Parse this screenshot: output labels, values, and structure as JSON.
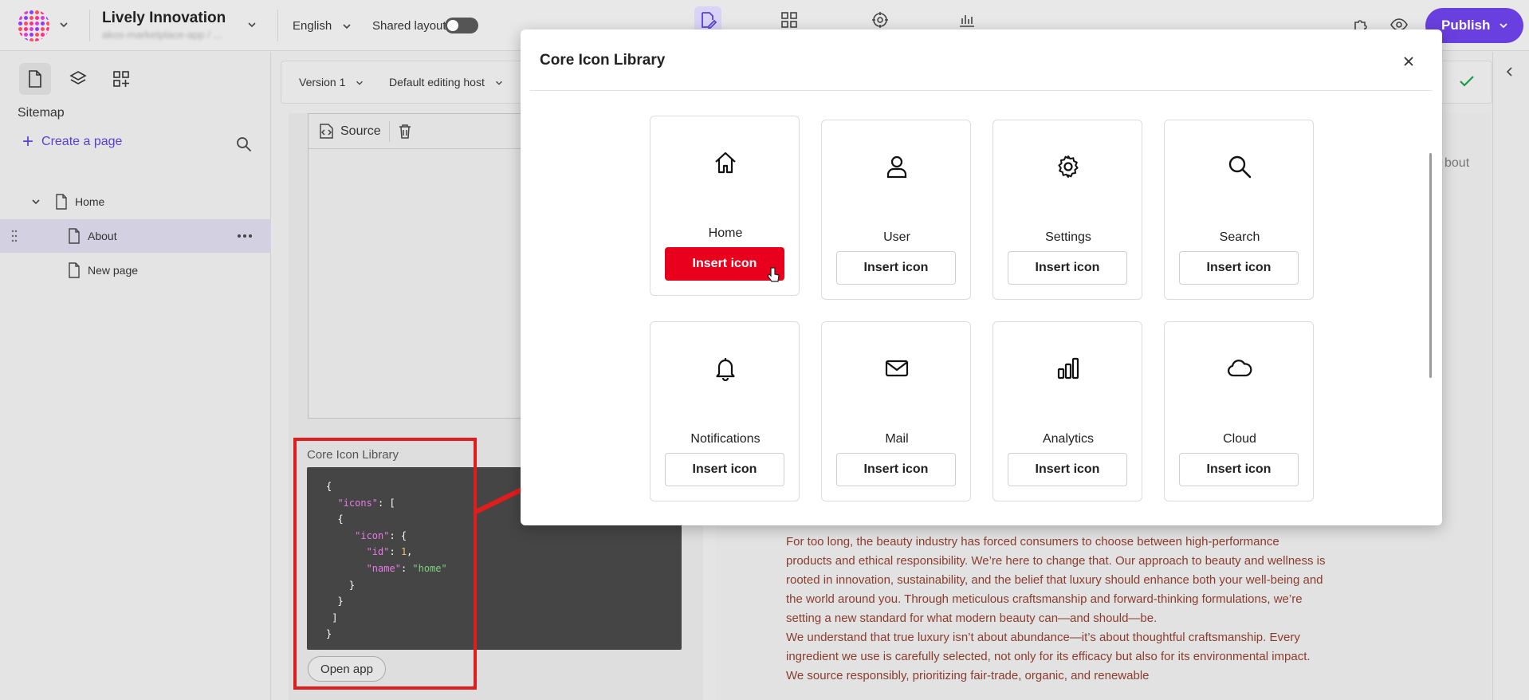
{
  "topbar": {
    "site_name": "Lively Innovation",
    "site_sub": "akos-marketplace-app / ...",
    "language": "English",
    "shared_layout_label": "Shared layout",
    "publish_label": "Publish"
  },
  "sidebar": {
    "title": "Sitemap",
    "create_page": "Create a page",
    "tree": [
      {
        "label": "Home"
      },
      {
        "label": "About"
      },
      {
        "label": "New page"
      }
    ]
  },
  "version_bar": {
    "version": "Version 1",
    "host": "Default editing host"
  },
  "editor": {
    "source_label": "Source",
    "component_label": "Core Icon Library",
    "open_app": "Open app"
  },
  "code": {
    "l1": "{",
    "k_icons": "\"icons\"",
    "l2_tail": ": [",
    "l3": "  {",
    "k_icon": "\"icon\"",
    "l4_tail": ": {",
    "k_id": "\"id\"",
    "v_id": "1",
    "k_name": "\"name\"",
    "v_name": "\"home\"",
    "l7": "    }",
    "l8": "  }",
    "l9": " ]",
    "l10": "}"
  },
  "preview": {
    "about_peek": "bout",
    "p1": "For too long, the beauty industry has forced consumers to choose between high-performance products and ethical responsibility. We’re here to change that. Our approach to beauty and wellness is rooted in innovation, sustainability, and the belief that luxury should enhance both your well-being and the world around you. Through meticulous craftsmanship and forward-thinking formulations, we’re setting a new standard for what modern beauty can—and should—be.",
    "p2": "We understand that true luxury isn’t about abundance—it’s about thoughtful craftsmanship. Every ingredient we use is carefully selected, not only for its efficacy but also for its environmental impact. We source responsibly, prioritizing fair-trade, organic, and renewable"
  },
  "modal": {
    "title": "Core Icon Library",
    "insert_label": "Insert icon",
    "icons": [
      {
        "label": "Home",
        "icon": "home-icon"
      },
      {
        "label": "User",
        "icon": "user-icon"
      },
      {
        "label": "Settings",
        "icon": "gear-icon"
      },
      {
        "label": "Search",
        "icon": "search-icon"
      },
      {
        "label": "Notifications",
        "icon": "bell-icon"
      },
      {
        "label": "Mail",
        "icon": "mail-icon"
      },
      {
        "label": "Analytics",
        "icon": "bar-chart-icon"
      },
      {
        "label": "Cloud",
        "icon": "cloud-icon"
      }
    ]
  },
  "colors": {
    "accent": "#6a3fe0",
    "insert_primary": "#e8001c",
    "highlight_frame": "#e01d1d"
  }
}
